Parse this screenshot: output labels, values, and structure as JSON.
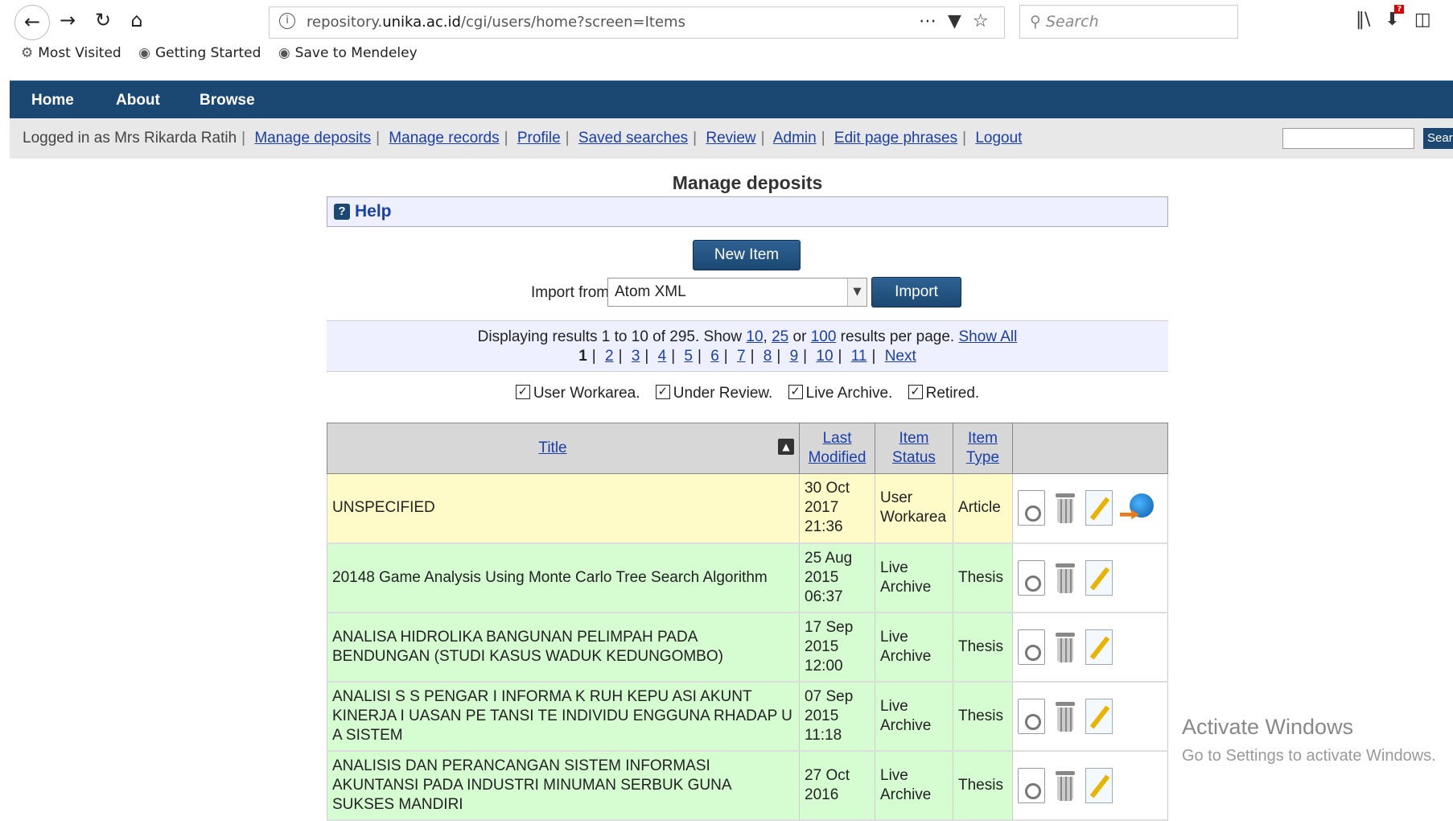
{
  "browser": {
    "url_prefix": "repository.",
    "url_domain": "unika.ac.id",
    "url_path": "/cgi/users/home?screen=Items",
    "search_placeholder": "Search",
    "bookmarks": [
      "Most Visited",
      "Getting Started",
      "Save to Mendeley"
    ]
  },
  "nav": {
    "items": [
      "Home",
      "About",
      "Browse"
    ]
  },
  "userbar": {
    "logged_in": "Logged in as Mrs Rikarda Ratih",
    "links": [
      "Manage deposits",
      "Manage records",
      "Profile",
      "Saved searches",
      "Review",
      "Admin",
      "Edit page phrases",
      "Logout"
    ],
    "search_button": "Sear"
  },
  "page": {
    "title": "Manage deposits",
    "help": "Help",
    "new_item": "New Item",
    "import_label": "Import from",
    "import_selected": "Atom XML",
    "import_button": "Import"
  },
  "paging": {
    "summary_pre": "Displaying results 1 to 10 of 295. Show",
    "opt1": "10",
    "opt2": "25",
    "or": "or",
    "opt3": "100",
    "summary_post": "results per page.",
    "show_all": "Show All",
    "current": "1",
    "pages": [
      "2",
      "3",
      "4",
      "5",
      "6",
      "7",
      "8",
      "9",
      "10",
      "11"
    ],
    "next": "Next"
  },
  "filters": [
    "User Workarea.",
    "Under Review.",
    "Live Archive.",
    "Retired."
  ],
  "table": {
    "headers": {
      "title": "Title",
      "last_modified_1": "Last",
      "last_modified_2": "Modified",
      "status_1": "Item",
      "status_2": "Status",
      "type_1": "Item",
      "type_2": "Type"
    },
    "rows": [
      {
        "title": "UNSPECIFIED",
        "date": "30 Oct",
        "year": "2017",
        "time": "21:36",
        "status1": "User",
        "status2": "Workarea",
        "type": "Article"
      },
      {
        "title": "20148 Game Analysis Using Monte Carlo Tree Search Algorithm",
        "date": "25 Aug",
        "year": "2015",
        "time": "06:37",
        "status1": "Live",
        "status2": "Archive",
        "type": "Thesis"
      },
      {
        "title": "ANALISA HIDROLIKA BANGUNAN PELIMPAH PADA BENDUNGAN (STUDI KASUS WADUK KEDUNGOMBO)",
        "date": "17 Sep",
        "year": "2015",
        "time": "12:00",
        "status1": "Live",
        "status2": "Archive",
        "type": "Thesis"
      },
      {
        "title": "ANALISI S S PENGAR I INFORMA K RUH KEPU ASI AKUNT KINERJA I UASAN PE TANSI TE INDIVIDU ENGGUNA RHADAP U A SISTEM",
        "date": "07 Sep",
        "year": "2015",
        "time": "11:18",
        "status1": "Live",
        "status2": "Archive",
        "type": "Thesis"
      },
      {
        "title": "ANALISIS DAN PERANCANGAN SISTEM INFORMASI AKUNTANSI PADA INDUSTRI MINUMAN SERBUK GUNA SUKSES MANDIRI",
        "date": "27 Oct",
        "year": "2016",
        "time": "",
        "status1": "Live",
        "status2": "Archive",
        "type": "Thesis"
      }
    ]
  },
  "watermark": {
    "line1": "Activate Windows",
    "line2": "Go to Settings to activate Windows."
  }
}
